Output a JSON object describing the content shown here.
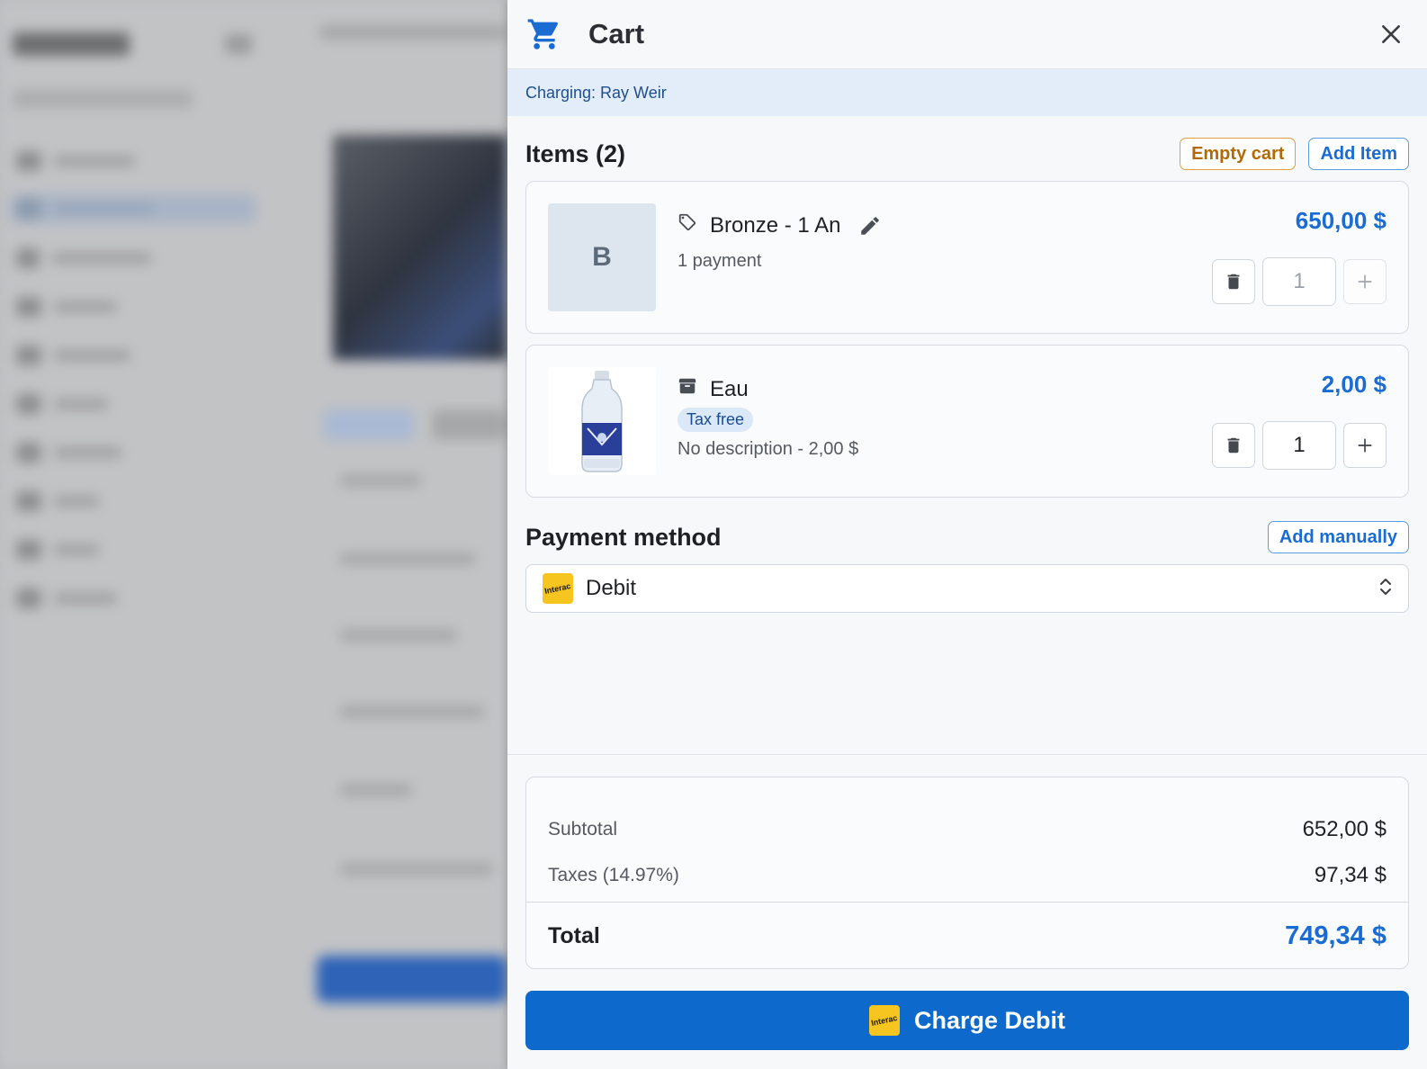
{
  "cart": {
    "title": "Cart",
    "charging_label": "Charging: Ray Weir"
  },
  "items_section": {
    "title": "Items (2)",
    "empty_cart_label": "Empty cart",
    "add_item_label": "Add Item"
  },
  "items": [
    {
      "thumb_letter": "B",
      "name": "Bronze - 1 An",
      "subtitle": "1 payment",
      "price": "650,00 $",
      "quantity": "1",
      "icon": "tag-icon"
    },
    {
      "name": "Eau",
      "badge": "Tax free",
      "description": "No description - 2,00 $",
      "price": "2,00 $",
      "quantity": "1",
      "icon": "archive-box-icon"
    }
  ],
  "payment": {
    "title": "Payment method",
    "add_manually_label": "Add manually",
    "selected_method": "Debit",
    "logo_text": "Interac"
  },
  "totals": {
    "subtotal_label": "Subtotal",
    "subtotal_value": "652,00 $",
    "taxes_label": "Taxes (14.97%)",
    "taxes_value": "97,34 $",
    "total_label": "Total",
    "total_value": "749,34 $"
  },
  "charge_button_label": "Charge Debit",
  "colors": {
    "accent": "#1a6cd2",
    "button": "#0d69cc",
    "warning": "#b26a06",
    "interac": "#f6c520"
  }
}
